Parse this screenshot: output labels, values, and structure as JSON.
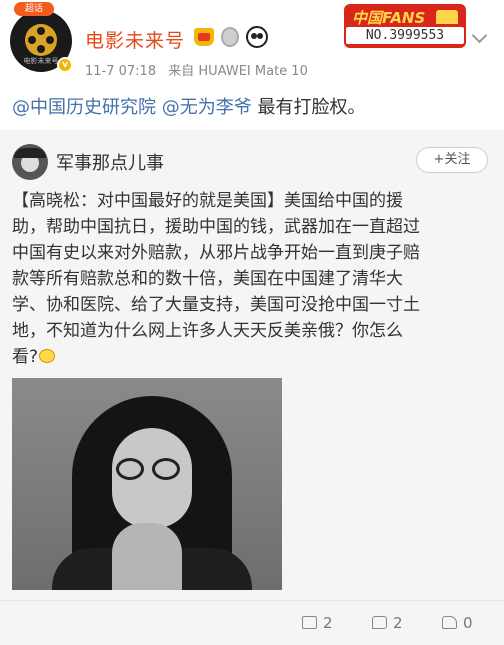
{
  "header": {
    "tag_badge": "超话",
    "avatar_caption": "电影未来号",
    "username": "电影未来号",
    "fans_title": "中国FANS",
    "fans_number": "NO.3999553",
    "timestamp": "11-7 07:18",
    "source": "来自 HUAWEI Mate 10"
  },
  "post": {
    "mention1": "@中国历史研究院",
    "mention2": "@无为李爷",
    "text": " 最有打脸权。"
  },
  "retweet": {
    "name": "军事那点儿事",
    "follow_label": "+关注",
    "lines": [
      "【高晓松：对中国最好的就是美国】美国给中国的援",
      "助，帮助中国抗日，援助中国的钱，武器加在一直超过",
      "中国有史以来对外赔款，从邪片战争开始一直到庚子赔",
      "款等所有赔款总和的数十倍，美国在中国建了清华大",
      "学、协和医院、给了大量支持，美国可没抢中国一寸土",
      "地，不知道为什么网上许多人天天反美亲俄？你怎么",
      "看?"
    ]
  },
  "actions": {
    "share_count": "2",
    "comment_count": "2",
    "like_count": "0"
  },
  "colors": {
    "username": "#e8491a",
    "mention": "#4471a8",
    "retweet_bg": "#f5f5f5"
  }
}
